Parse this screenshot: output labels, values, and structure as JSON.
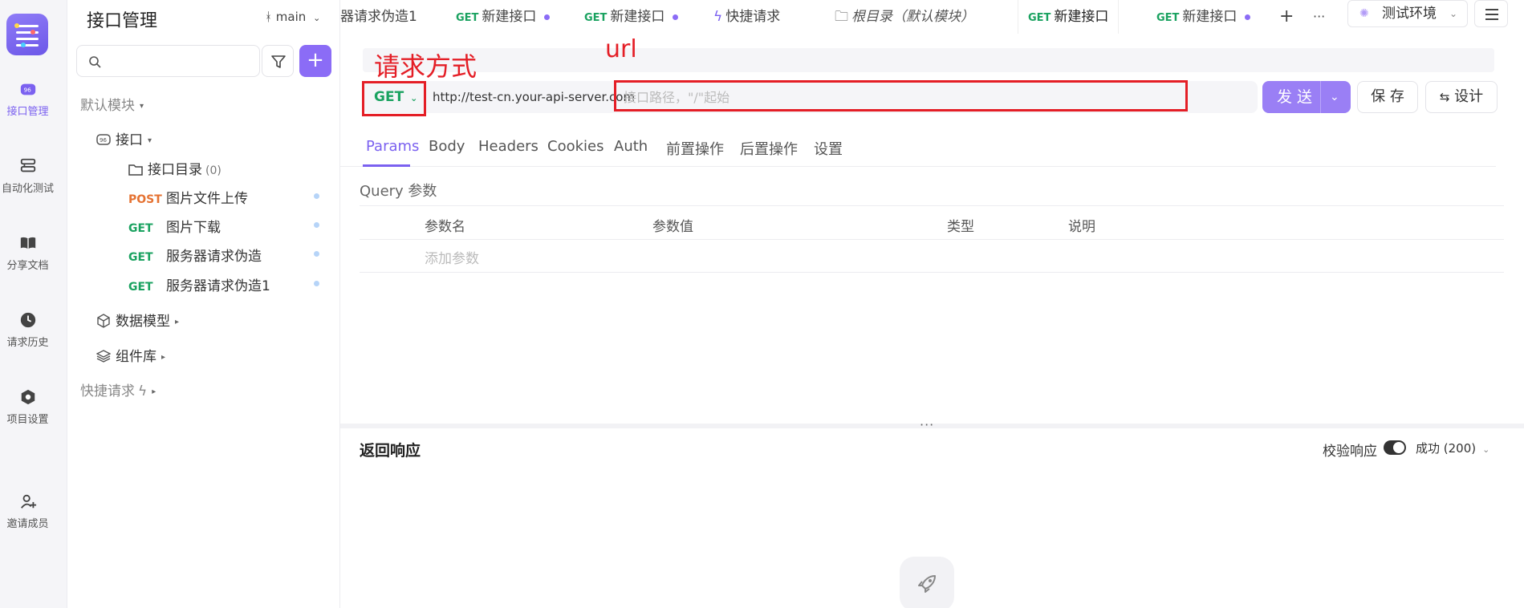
{
  "rail": {
    "items": [
      {
        "label": "接口管理"
      },
      {
        "label": "自动化测试"
      },
      {
        "label": "分享文档"
      },
      {
        "label": "请求历史"
      },
      {
        "label": "项目设置"
      },
      {
        "label": "邀请成员"
      }
    ]
  },
  "sidebar": {
    "title": "接口管理",
    "branch": "main",
    "add_symbol": "+",
    "module": "默认模块",
    "api_group": "接口",
    "api_dir": "接口目录",
    "api_dir_count": "(0)",
    "apis": [
      {
        "method": "POST",
        "name": "图片文件上传"
      },
      {
        "method": "GET",
        "name": "图片下载"
      },
      {
        "method": "GET",
        "name": "服务器请求伪造"
      },
      {
        "method": "GET",
        "name": "服务器请求伪造1"
      }
    ],
    "data_model": "数据模型",
    "components": "组件库",
    "quick_request": "快捷请求"
  },
  "tabs": [
    {
      "method": "",
      "label": "器请求伪造1"
    },
    {
      "method": "GET",
      "label": "新建接口"
    },
    {
      "method": "GET",
      "label": "新建接口"
    },
    {
      "method": "",
      "label": "快捷请求"
    },
    {
      "method": "",
      "label": "根目录（默认模块）"
    },
    {
      "method": "GET",
      "label": "新建接口"
    },
    {
      "method": "GET",
      "label": "新建接口"
    }
  ],
  "tab_add_symbol": "+",
  "tab_more_symbol": "···",
  "environment": "测试环境",
  "request": {
    "method": "GET",
    "base_url": "http://test-cn.your-api-server.com",
    "path_placeholder": "接口路径，\"/\"起始",
    "send_label": "发 送",
    "save_label": "保 存",
    "design_label": "设计"
  },
  "annotations": {
    "method_label": "请求方式",
    "url_label": "url"
  },
  "subtabs": [
    "Params",
    "Body",
    "Headers",
    "Cookies",
    "Auth",
    "前置操作",
    "后置操作",
    "设置"
  ],
  "query": {
    "title": "Query 参数",
    "headers": [
      "参数名",
      "参数值",
      "类型",
      "说明"
    ],
    "add_placeholder": "添加参数"
  },
  "response": {
    "title": "返回响应",
    "verify_label": "校验响应",
    "status": "成功 (200)"
  },
  "colors": {
    "accent": "#7b61f0",
    "get": "#1aa260",
    "post": "#e57232",
    "annotation": "#e41e26"
  }
}
